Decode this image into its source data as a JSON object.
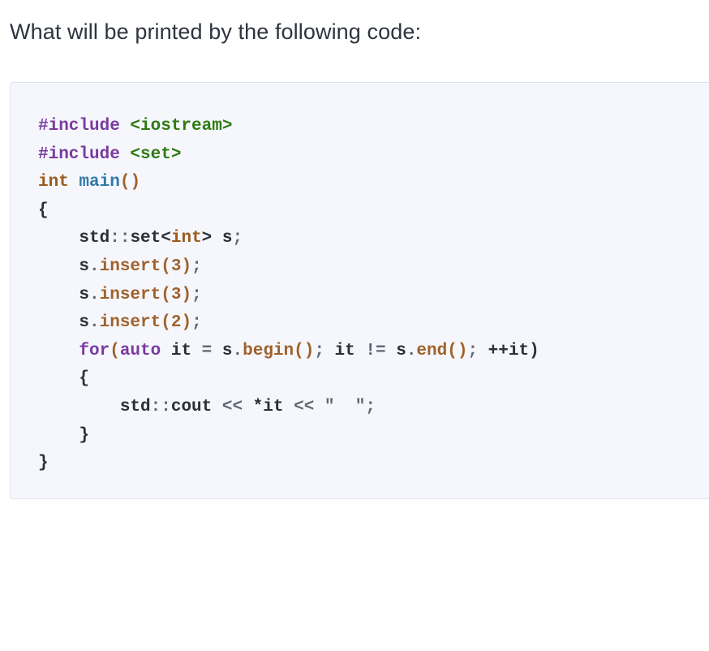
{
  "question": {
    "text": "What will be printed by the following code:"
  },
  "code": {
    "lines": [
      [
        {
          "text": "#include ",
          "cls": "kw-include"
        },
        {
          "text": "<iostream>",
          "cls": "str-header"
        }
      ],
      [
        {
          "text": "#include ",
          "cls": "kw-include"
        },
        {
          "text": "<set>",
          "cls": "str-header"
        }
      ],
      [
        {
          "text": "int ",
          "cls": "kw-type"
        },
        {
          "text": "main",
          "cls": "fn-main"
        },
        {
          "text": "()",
          "cls": "paren-brown"
        }
      ],
      [
        {
          "text": "{",
          "cls": "plain"
        }
      ],
      [
        {
          "text": "    std",
          "cls": "plain"
        },
        {
          "text": "::",
          "cls": "punct"
        },
        {
          "text": "set",
          "cls": "plain"
        },
        {
          "text": "<",
          "cls": "plain"
        },
        {
          "text": "int",
          "cls": "kw-type"
        },
        {
          "text": "> s",
          "cls": "plain"
        },
        {
          "text": ";",
          "cls": "punct"
        }
      ],
      [
        {
          "text": "    s",
          "cls": "plain"
        },
        {
          "text": ".",
          "cls": "punct"
        },
        {
          "text": "insert",
          "cls": "method"
        },
        {
          "text": "(",
          "cls": "paren-brown"
        },
        {
          "text": "3",
          "cls": "num"
        },
        {
          "text": ")",
          "cls": "paren-brown"
        },
        {
          "text": ";",
          "cls": "punct"
        }
      ],
      [
        {
          "text": "    s",
          "cls": "plain"
        },
        {
          "text": ".",
          "cls": "punct"
        },
        {
          "text": "insert",
          "cls": "method"
        },
        {
          "text": "(",
          "cls": "paren-brown"
        },
        {
          "text": "3",
          "cls": "num"
        },
        {
          "text": ")",
          "cls": "paren-brown"
        },
        {
          "text": ";",
          "cls": "punct"
        }
      ],
      [
        {
          "text": "    s",
          "cls": "plain"
        },
        {
          "text": ".",
          "cls": "punct"
        },
        {
          "text": "insert",
          "cls": "method"
        },
        {
          "text": "(",
          "cls": "paren-brown"
        },
        {
          "text": "2",
          "cls": "num"
        },
        {
          "text": ")",
          "cls": "paren-brown"
        },
        {
          "text": ";",
          "cls": "punct"
        }
      ],
      [
        {
          "text": "    for",
          "cls": "kw-for"
        },
        {
          "text": "(",
          "cls": "paren-brown"
        },
        {
          "text": "auto",
          "cls": "kw-auto"
        },
        {
          "text": " it ",
          "cls": "plain"
        },
        {
          "text": "=",
          "cls": "punct"
        },
        {
          "text": " s",
          "cls": "plain"
        },
        {
          "text": ".",
          "cls": "punct"
        },
        {
          "text": "begin",
          "cls": "method"
        },
        {
          "text": "()",
          "cls": "paren-brown"
        },
        {
          "text": ";",
          "cls": "punct"
        },
        {
          "text": " it ",
          "cls": "plain"
        },
        {
          "text": "!=",
          "cls": "punct"
        },
        {
          "text": " s",
          "cls": "plain"
        },
        {
          "text": ".",
          "cls": "punct"
        },
        {
          "text": "end",
          "cls": "method"
        },
        {
          "text": "()",
          "cls": "paren-brown"
        },
        {
          "text": ";",
          "cls": "punct"
        },
        {
          "text": " ++it)",
          "cls": "plain"
        }
      ],
      [
        {
          "text": "    {",
          "cls": "plain"
        }
      ],
      [
        {
          "text": "        std",
          "cls": "plain"
        },
        {
          "text": "::",
          "cls": "punct"
        },
        {
          "text": "cout ",
          "cls": "plain"
        },
        {
          "text": "<<",
          "cls": "punct"
        },
        {
          "text": " *it ",
          "cls": "plain"
        },
        {
          "text": "<<",
          "cls": "punct"
        },
        {
          "text": " \"  \";",
          "cls": "punct"
        }
      ],
      [
        {
          "text": "    }",
          "cls": "plain"
        }
      ],
      [
        {
          "text": "}",
          "cls": "plain"
        }
      ]
    ]
  }
}
